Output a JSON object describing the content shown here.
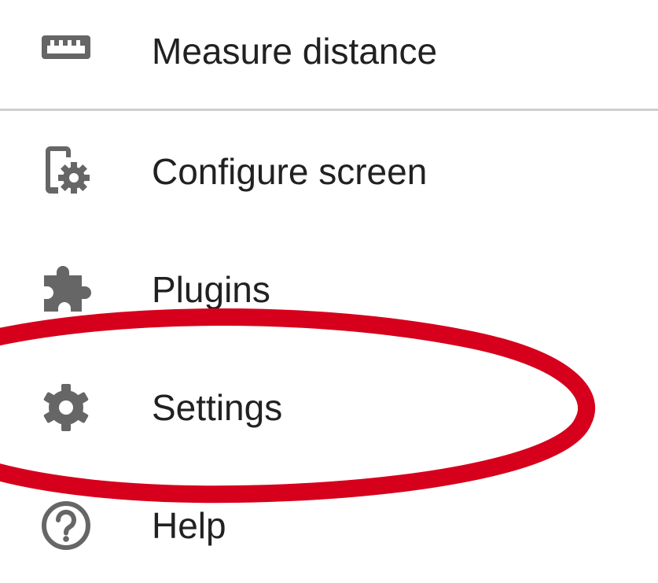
{
  "menu": {
    "items": [
      {
        "id": "measure",
        "label": "Measure distance",
        "icon": "ruler-icon"
      },
      {
        "id": "configure",
        "label": "Configure screen",
        "icon": "phone-settings-icon"
      },
      {
        "id": "plugins",
        "label": "Plugins",
        "icon": "puzzle-icon"
      },
      {
        "id": "settings",
        "label": "Settings",
        "icon": "gear-icon"
      },
      {
        "id": "help",
        "label": "Help",
        "icon": "help-circle-icon"
      }
    ]
  },
  "colors": {
    "icon": "#666666",
    "text": "#212121",
    "divider": "#cfcfcf",
    "annotation": "#d6001c"
  },
  "annotation": {
    "shape": "ellipse",
    "target": "settings"
  }
}
